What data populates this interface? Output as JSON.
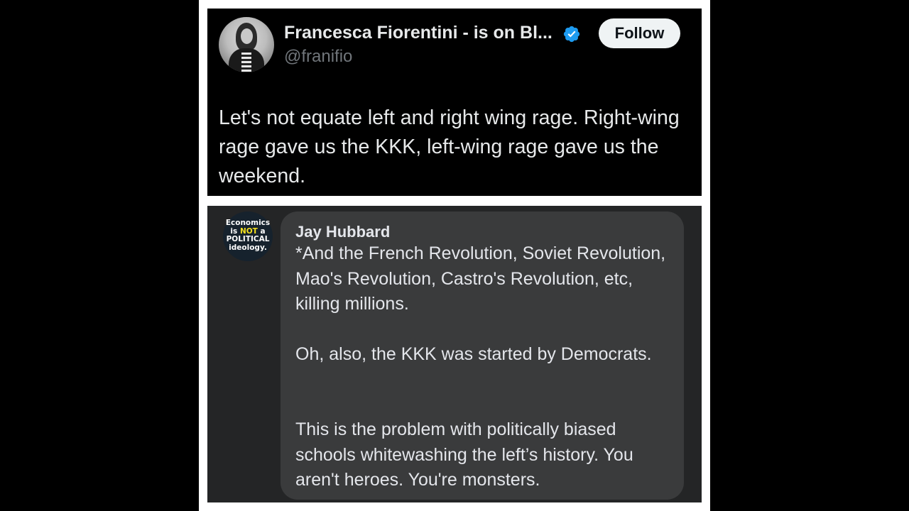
{
  "tweet": {
    "display_name": "Francesca Fiorentini - is on Bl...",
    "handle": "@franifio",
    "follow_label": "Follow",
    "text": "Let's not equate left and right wing rage. Right-wing rage gave us the KKK, left-wing rage gave us the weekend.",
    "verified_color": "#1d9bf0",
    "avatar_icon": "profile-photo"
  },
  "comment": {
    "author": "Jay Hubbard",
    "avatar_text": {
      "line1": "Economics",
      "line2_pre": "is ",
      "line2_em": "NOT",
      "line2_post": " a",
      "line3": "POLITICAL",
      "line4": "ideology."
    },
    "paragraphs": [
      "*And the French Revolution, Soviet Revolution, Mao's Revolution, Castro's Revolution, etc, killing millions.",
      "Oh, also, the KKK was started by Democrats.",
      "This is the problem with politically biased schools whitewashing the left’s history. You aren't heroes. You're monsters."
    ]
  },
  "colors": {
    "tweet_bg": "#000000",
    "comment_panel_bg": "#242526",
    "comment_bubble_bg": "#3a3b3c",
    "avatar_highlight": "#f5e11f"
  }
}
